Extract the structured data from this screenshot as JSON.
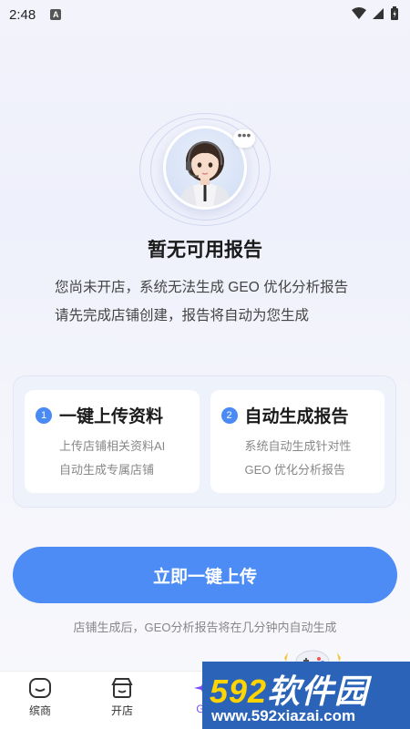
{
  "status_bar": {
    "time": "2:48",
    "badge": "A"
  },
  "empty_state": {
    "title": "暂无可用报告",
    "description": "您尚未开店，系统无法生成 GEO 优化分析报告 请先完成店铺创建，报告将自动为您生成"
  },
  "steps": [
    {
      "number": "1",
      "title": "一键上传资料",
      "desc_line1": "上传店铺相关资料AI",
      "desc_line2": "自动生成专属店铺"
    },
    {
      "number": "2",
      "title": "自动生成报告",
      "desc_line1": "系统自动生成针对性",
      "desc_line2": "GEO 优化分析报告"
    }
  ],
  "primary_button": "立即一键上传",
  "hint": "店铺生成后，GEO分析报告将在几分钟内自动生成",
  "tabbar": {
    "tabs": [
      {
        "label": "缤商",
        "icon": "smile-icon"
      },
      {
        "label": "开店",
        "icon": "shop-icon"
      },
      {
        "label": "GE",
        "icon": "star-icon"
      }
    ]
  },
  "watermark": {
    "brand_number": "592",
    "brand_text": "软件园",
    "url": "www.592xiazai.com"
  },
  "colors": {
    "accent": "#4d8cf5",
    "step_badge": "#4a8af4",
    "watermark_bg": "#2a63b8",
    "watermark_highlight": "#ffd400"
  }
}
